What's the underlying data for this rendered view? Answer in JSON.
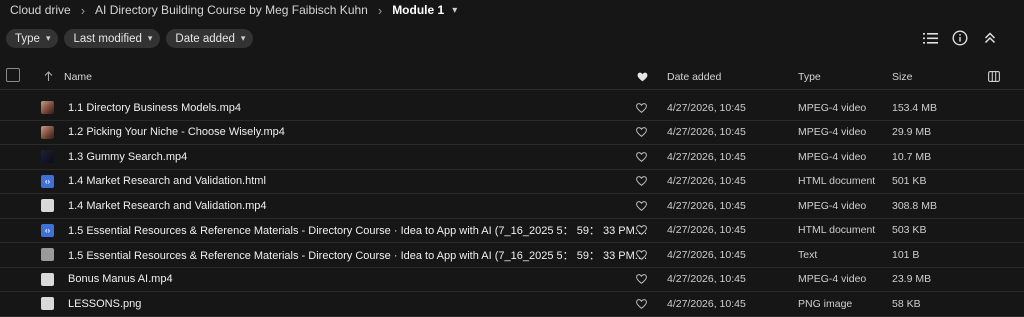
{
  "breadcrumb": {
    "items": [
      "Cloud drive",
      "AI Directory Building Course by Meg Faibisch Kuhn"
    ],
    "current": "Module 1"
  },
  "filters": [
    "Type",
    "Last modified",
    "Date added"
  ],
  "toolbar": {
    "icons": [
      "list-view-icon",
      "info-icon",
      "collapse-icon"
    ]
  },
  "table": {
    "columns": {
      "name": "Name",
      "date_added": "Date added",
      "type": "Type",
      "size": "Size"
    },
    "rows": [
      {
        "name": "1.1 Directory Business Models.mp4",
        "date": "4/27/2026, 10:45",
        "type": "MPEG-4 video",
        "size": "153.4 MB",
        "icon": "thumb"
      },
      {
        "name": "1.2 Picking Your Niche - Choose Wisely.mp4",
        "date": "4/27/2026, 10:45",
        "type": "MPEG-4 video",
        "size": "29.9 MB",
        "icon": "thumb"
      },
      {
        "name": "1.3 Gummy Search.mp4",
        "date": "4/27/2026, 10:45",
        "type": "MPEG-4 video",
        "size": "10.7 MB",
        "icon": "dark"
      },
      {
        "name": "1.4 Market Research and Validation.html",
        "date": "4/27/2026, 10:45",
        "type": "HTML document",
        "size": "501 KB",
        "icon": "html"
      },
      {
        "name": "1.4 Market Research and Validation.mp4",
        "date": "4/27/2026, 10:45",
        "type": "MPEG-4 video",
        "size": "308.8 MB",
        "icon": "doc"
      },
      {
        "name": "1.5 Essential Resources & Reference Materials - Directory Course · Idea to App with AI (7_16_2025 5： 59： 33 PM....",
        "date": "4/27/2026, 10:45",
        "type": "HTML document",
        "size": "503 KB",
        "icon": "html"
      },
      {
        "name": "1.5 Essential Resources & Reference Materials - Directory Course · Idea to App with AI (7_16_2025 5： 59： 33 PM....",
        "date": "4/27/2026, 10:45",
        "type": "Text",
        "size": "101 B",
        "icon": "text"
      },
      {
        "name": "Bonus Manus AI.mp4",
        "date": "4/27/2026, 10:45",
        "type": "MPEG-4 video",
        "size": "23.9 MB",
        "icon": "doc"
      },
      {
        "name": "LESSONS.png",
        "date": "4/27/2026, 10:45",
        "type": "PNG image",
        "size": "58 KB",
        "icon": "doc"
      }
    ]
  }
}
